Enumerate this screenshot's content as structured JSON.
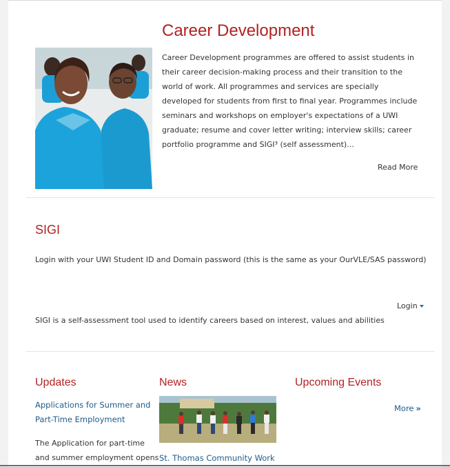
{
  "career": {
    "title": "Career Development",
    "body": "Career Development programmes are offered to assist students in their career decision-making process and their transition to the world of work. All programmes and services are specially developed for students from first to final year. Programmes include seminars and workshops on employer's expectations of a UWI graduate; resume and cover letter writing; interview skills; career portfolio programme and SIGI³ (self assessment)...",
    "read_more": "Read More"
  },
  "sigi": {
    "title": "SIGI",
    "login_text": "Login with your UWI Student ID and Domain password (this is the same as your OurVLE/SAS password)",
    "login_label": "Login",
    "description": "SIGI is a self-assessment tool used to identify careers based on interest, values and abilities"
  },
  "updates": {
    "title": "Updates",
    "link": "Applications for Summer and Part-Time Employment",
    "text": "The Application for part-time and summer employment opens"
  },
  "news": {
    "title": "News",
    "caption": "St. Thomas Community Work"
  },
  "events": {
    "title": "Upcoming Events",
    "more": "More",
    "more_icon": "»"
  },
  "colors": {
    "accent_red": "#b22222",
    "link_blue": "#1f5b8a"
  }
}
